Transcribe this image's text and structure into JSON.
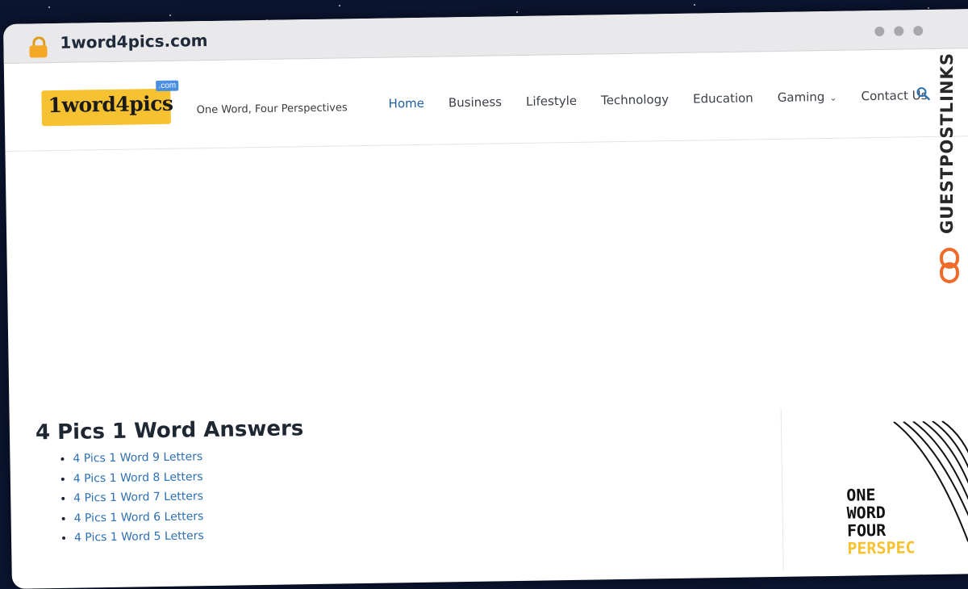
{
  "browser": {
    "url": "1word4pics.com"
  },
  "header": {
    "logo_text": "1word4pics",
    "logo_badge": ".com",
    "tagline": "One Word, Four Perspectives",
    "nav": [
      {
        "label": "Home",
        "active": true
      },
      {
        "label": "Business"
      },
      {
        "label": "Lifestyle"
      },
      {
        "label": "Technology"
      },
      {
        "label": "Education"
      },
      {
        "label": "Gaming",
        "has_dropdown": true
      },
      {
        "label": "Contact Us"
      }
    ]
  },
  "main": {
    "title": "4 Pics 1 Word Answers",
    "links": [
      "4 Pics 1 Word 9 Letters",
      "4 Pics 1 Word 8 Letters",
      "4 Pics 1 Word 7 Letters",
      "4 Pics 1 Word 6 Letters",
      "4 Pics 1 Word 5 Letters"
    ]
  },
  "sidebar_art": {
    "words": [
      "ONE",
      "WORD",
      "FOUR",
      "PERSPEC"
    ]
  },
  "watermark": {
    "text": "GUESTPOSTLINKS"
  },
  "colors": {
    "accent_link": "#2c6fb3",
    "nav_active": "#1d5fa0",
    "logo_bg": "#f6c232",
    "watermark_icon": "#f06a2a"
  }
}
